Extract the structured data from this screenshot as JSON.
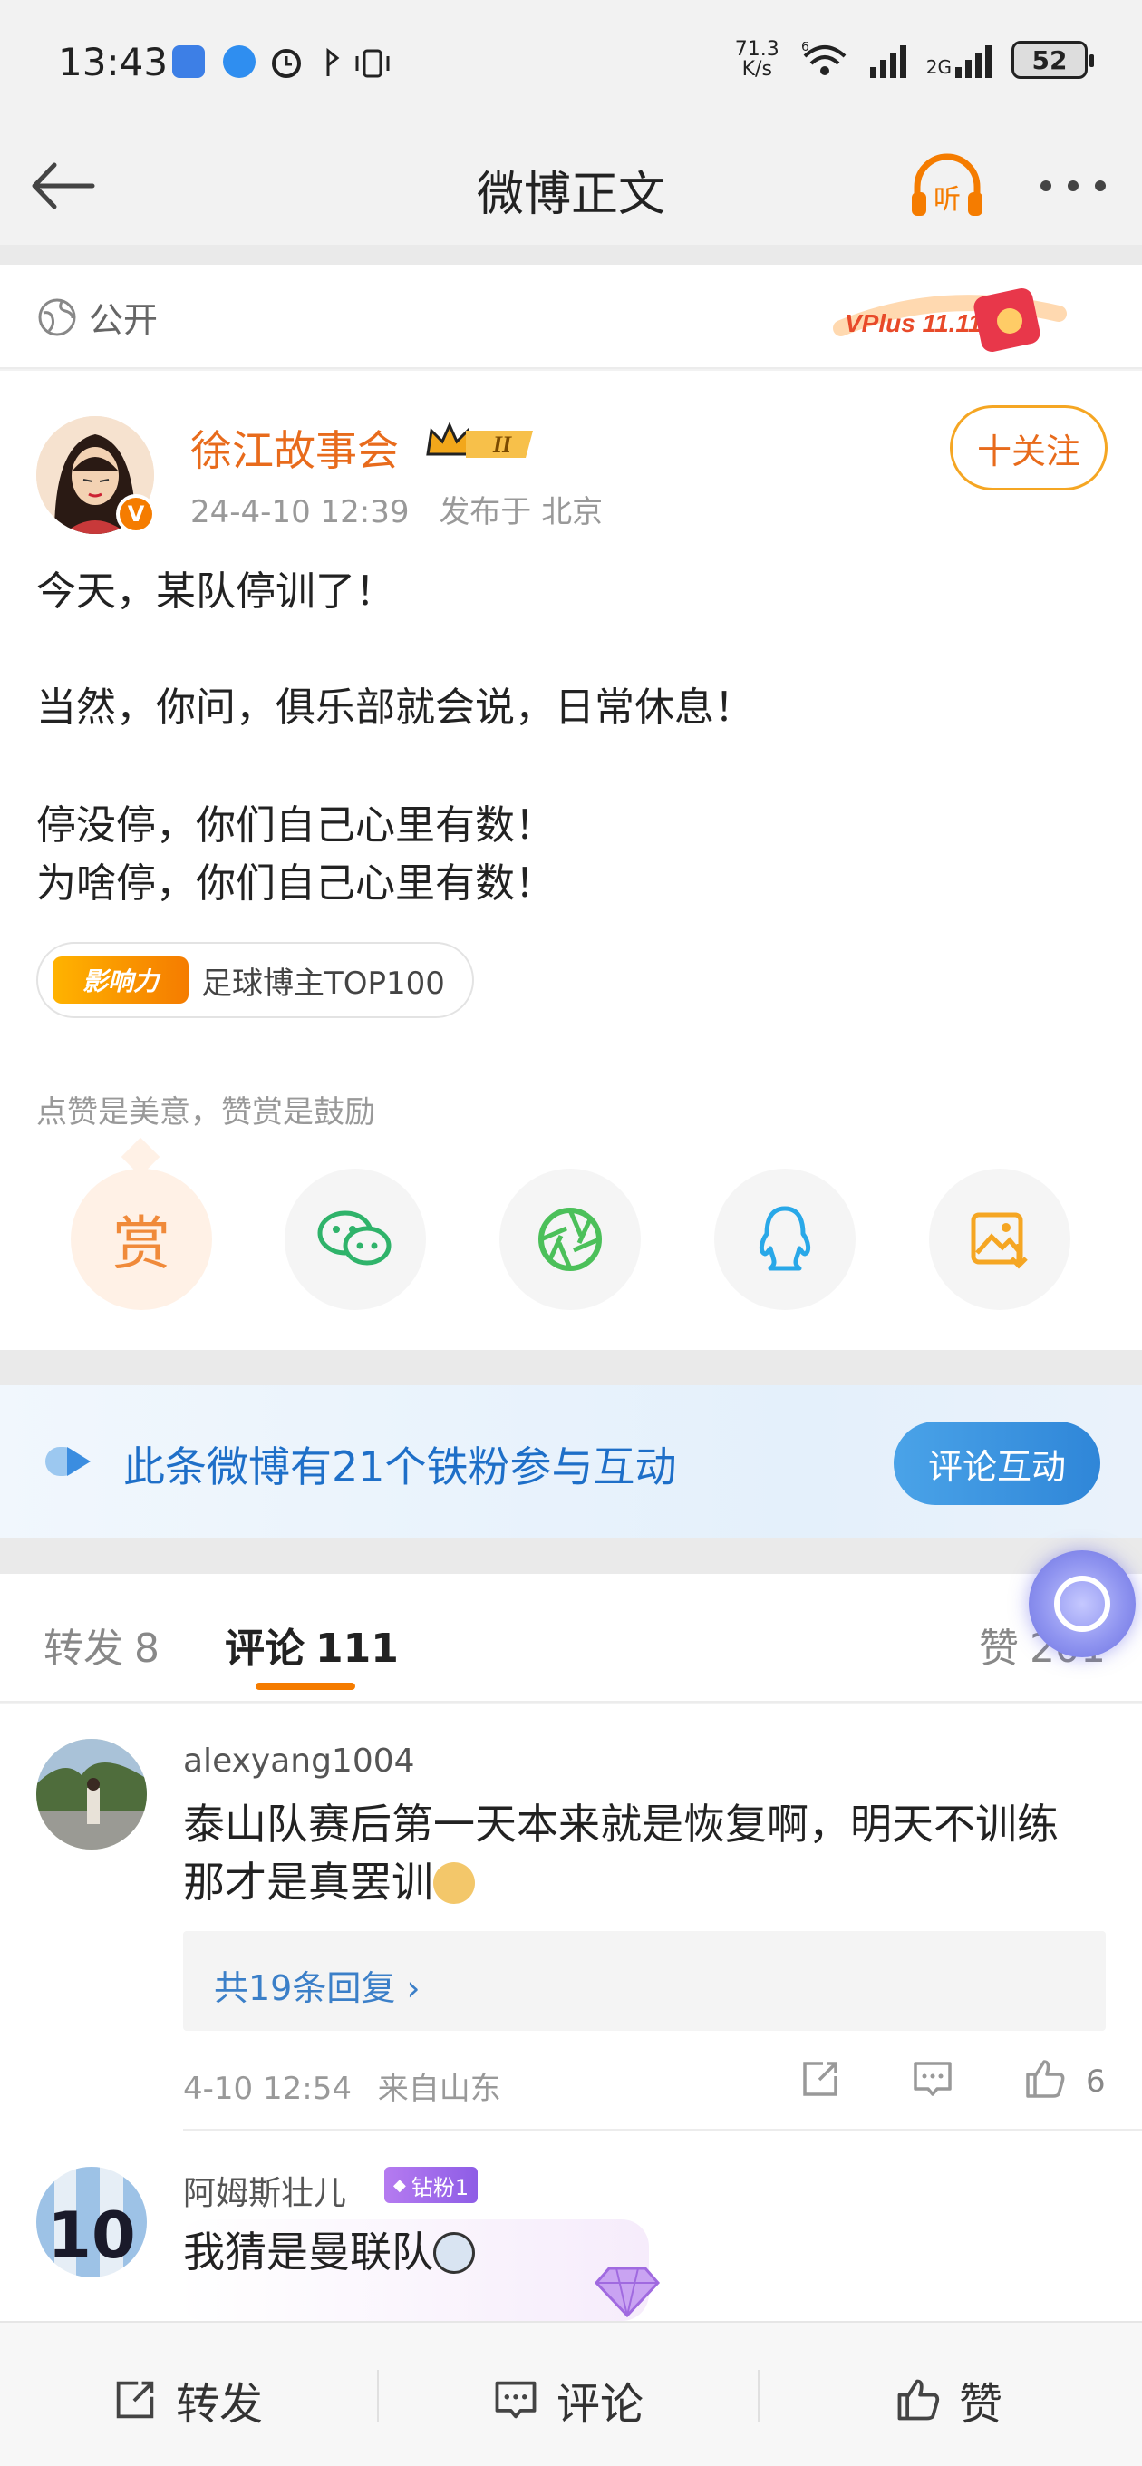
{
  "status_bar": {
    "time": "13:43",
    "net_speed_value": "71.3",
    "net_speed_unit": "K/s",
    "wifi_label": "6",
    "sim2_label": "2G",
    "battery": "52"
  },
  "nav": {
    "title": "微博正文",
    "listen_label": "听"
  },
  "visibility": {
    "label": "公开",
    "promo_text": "VPlus 11.11"
  },
  "post": {
    "author": "徐江故事会",
    "rank_badge": "II",
    "verified_badge": "V",
    "date": "24-4-10 12:39",
    "location": "发布于 北京",
    "follow_label": "十关注",
    "lines": [
      "今天，某队停训了！",
      "当然，你问，俱乐部就会说，日常休息！",
      "停没停，你们自己心里有数！",
      "为啥停，你们自己心里有数！"
    ],
    "tag_badge": "影响力",
    "tag_text": "足球博主TOP100",
    "praise_hint": "点赞是美意，赞赏是鼓励",
    "reward_label": "赏"
  },
  "fans_banner": {
    "text": "此条微博有21个铁粉参与互动",
    "button": "评论互动"
  },
  "tabs": {
    "repost_label": "转发",
    "repost_count": "8",
    "comment_label": "评论",
    "comment_count": "111",
    "like_label": "赞",
    "like_count": "201"
  },
  "comments": [
    {
      "user": "alexyang1004",
      "text": "泰山队赛后第一天本来就是恢复啊，明天不训练那才是真罢训",
      "replies": "共19条回复 ›",
      "date": "4-10 12:54",
      "source": "来自山东",
      "likes": "6"
    },
    {
      "user": "阿姆斯壮儿",
      "fan_badge": "钻粉1",
      "text": "我猜是曼联队"
    }
  ],
  "bottom_bar": {
    "repost": "转发",
    "comment": "评论",
    "like": "赞"
  },
  "colors": {
    "accent": "#f57c00",
    "link": "#3b7fc8",
    "fans_blue": "#1e6fc8"
  }
}
